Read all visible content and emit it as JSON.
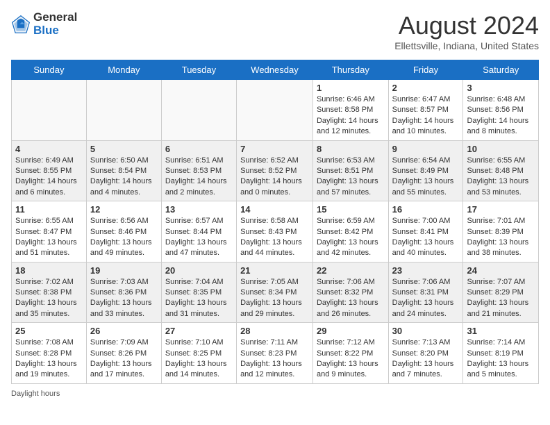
{
  "header": {
    "logo_general": "General",
    "logo_blue": "Blue",
    "month_year": "August 2024",
    "location": "Ellettsville, Indiana, United States"
  },
  "days_of_week": [
    "Sunday",
    "Monday",
    "Tuesday",
    "Wednesday",
    "Thursday",
    "Friday",
    "Saturday"
  ],
  "weeks": [
    [
      {
        "day": "",
        "text": ""
      },
      {
        "day": "",
        "text": ""
      },
      {
        "day": "",
        "text": ""
      },
      {
        "day": "",
        "text": ""
      },
      {
        "day": "1",
        "text": "Sunrise: 6:46 AM\nSunset: 8:58 PM\nDaylight: 14 hours and 12 minutes."
      },
      {
        "day": "2",
        "text": "Sunrise: 6:47 AM\nSunset: 8:57 PM\nDaylight: 14 hours and 10 minutes."
      },
      {
        "day": "3",
        "text": "Sunrise: 6:48 AM\nSunset: 8:56 PM\nDaylight: 14 hours and 8 minutes."
      }
    ],
    [
      {
        "day": "4",
        "text": "Sunrise: 6:49 AM\nSunset: 8:55 PM\nDaylight: 14 hours and 6 minutes."
      },
      {
        "day": "5",
        "text": "Sunrise: 6:50 AM\nSunset: 8:54 PM\nDaylight: 14 hours and 4 minutes."
      },
      {
        "day": "6",
        "text": "Sunrise: 6:51 AM\nSunset: 8:53 PM\nDaylight: 14 hours and 2 minutes."
      },
      {
        "day": "7",
        "text": "Sunrise: 6:52 AM\nSunset: 8:52 PM\nDaylight: 14 hours and 0 minutes."
      },
      {
        "day": "8",
        "text": "Sunrise: 6:53 AM\nSunset: 8:51 PM\nDaylight: 13 hours and 57 minutes."
      },
      {
        "day": "9",
        "text": "Sunrise: 6:54 AM\nSunset: 8:49 PM\nDaylight: 13 hours and 55 minutes."
      },
      {
        "day": "10",
        "text": "Sunrise: 6:55 AM\nSunset: 8:48 PM\nDaylight: 13 hours and 53 minutes."
      }
    ],
    [
      {
        "day": "11",
        "text": "Sunrise: 6:55 AM\nSunset: 8:47 PM\nDaylight: 13 hours and 51 minutes."
      },
      {
        "day": "12",
        "text": "Sunrise: 6:56 AM\nSunset: 8:46 PM\nDaylight: 13 hours and 49 minutes."
      },
      {
        "day": "13",
        "text": "Sunrise: 6:57 AM\nSunset: 8:44 PM\nDaylight: 13 hours and 47 minutes."
      },
      {
        "day": "14",
        "text": "Sunrise: 6:58 AM\nSunset: 8:43 PM\nDaylight: 13 hours and 44 minutes."
      },
      {
        "day": "15",
        "text": "Sunrise: 6:59 AM\nSunset: 8:42 PM\nDaylight: 13 hours and 42 minutes."
      },
      {
        "day": "16",
        "text": "Sunrise: 7:00 AM\nSunset: 8:41 PM\nDaylight: 13 hours and 40 minutes."
      },
      {
        "day": "17",
        "text": "Sunrise: 7:01 AM\nSunset: 8:39 PM\nDaylight: 13 hours and 38 minutes."
      }
    ],
    [
      {
        "day": "18",
        "text": "Sunrise: 7:02 AM\nSunset: 8:38 PM\nDaylight: 13 hours and 35 minutes."
      },
      {
        "day": "19",
        "text": "Sunrise: 7:03 AM\nSunset: 8:36 PM\nDaylight: 13 hours and 33 minutes."
      },
      {
        "day": "20",
        "text": "Sunrise: 7:04 AM\nSunset: 8:35 PM\nDaylight: 13 hours and 31 minutes."
      },
      {
        "day": "21",
        "text": "Sunrise: 7:05 AM\nSunset: 8:34 PM\nDaylight: 13 hours and 29 minutes."
      },
      {
        "day": "22",
        "text": "Sunrise: 7:06 AM\nSunset: 8:32 PM\nDaylight: 13 hours and 26 minutes."
      },
      {
        "day": "23",
        "text": "Sunrise: 7:06 AM\nSunset: 8:31 PM\nDaylight: 13 hours and 24 minutes."
      },
      {
        "day": "24",
        "text": "Sunrise: 7:07 AM\nSunset: 8:29 PM\nDaylight: 13 hours and 21 minutes."
      }
    ],
    [
      {
        "day": "25",
        "text": "Sunrise: 7:08 AM\nSunset: 8:28 PM\nDaylight: 13 hours and 19 minutes."
      },
      {
        "day": "26",
        "text": "Sunrise: 7:09 AM\nSunset: 8:26 PM\nDaylight: 13 hours and 17 minutes."
      },
      {
        "day": "27",
        "text": "Sunrise: 7:10 AM\nSunset: 8:25 PM\nDaylight: 13 hours and 14 minutes."
      },
      {
        "day": "28",
        "text": "Sunrise: 7:11 AM\nSunset: 8:23 PM\nDaylight: 13 hours and 12 minutes."
      },
      {
        "day": "29",
        "text": "Sunrise: 7:12 AM\nSunset: 8:22 PM\nDaylight: 13 hours and 9 minutes."
      },
      {
        "day": "30",
        "text": "Sunrise: 7:13 AM\nSunset: 8:20 PM\nDaylight: 13 hours and 7 minutes."
      },
      {
        "day": "31",
        "text": "Sunrise: 7:14 AM\nSunset: 8:19 PM\nDaylight: 13 hours and 5 minutes."
      }
    ]
  ],
  "footer": {
    "daylight_label": "Daylight hours"
  },
  "colors": {
    "header_bg": "#1a6fc4",
    "accent": "#1a5ca8"
  }
}
